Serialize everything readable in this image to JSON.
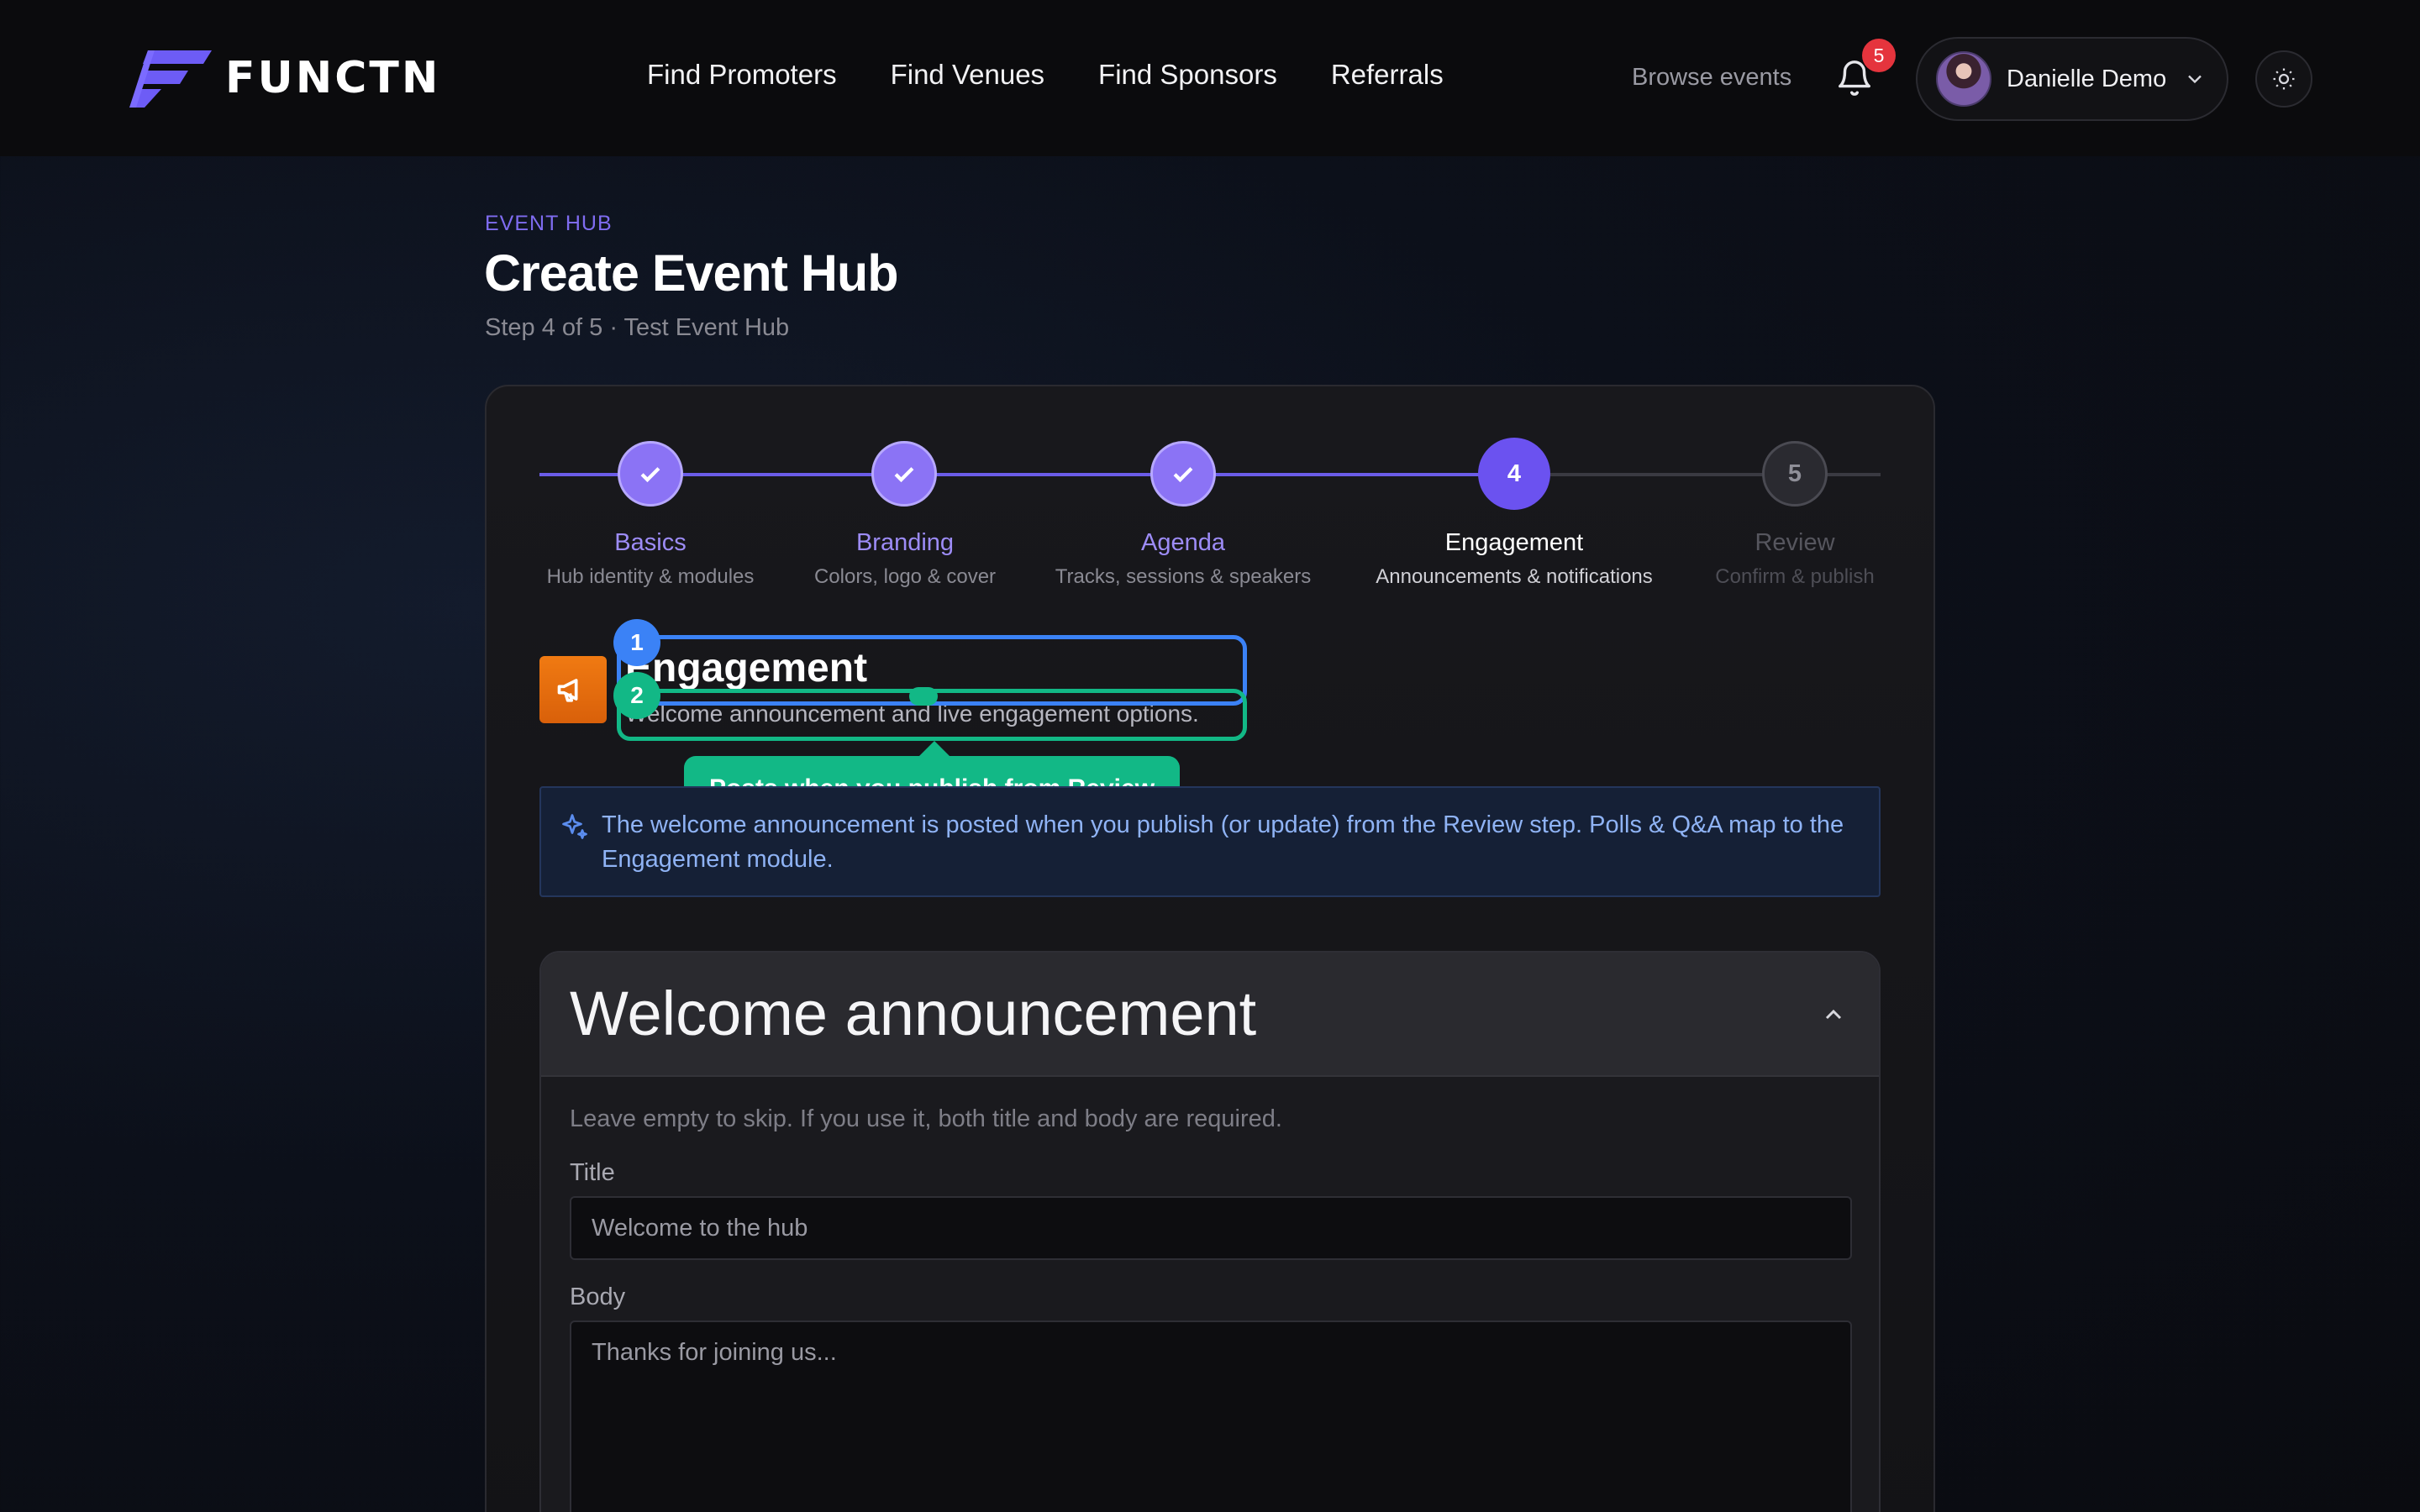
{
  "header": {
    "brand": "FUNCTN",
    "nav": [
      "Find Promoters",
      "Find Venues",
      "Find Sponsors",
      "Referrals"
    ],
    "browse_label": "Browse events",
    "notification_count": "5",
    "user_name": "Danielle Demo"
  },
  "page": {
    "eyebrow": "EVENT HUB",
    "title": "Create Event Hub",
    "subtitle": "Step 4 of 5 · Test Event Hub"
  },
  "stepper": {
    "current": 4,
    "steps": [
      {
        "label": "Basics",
        "desc": "Hub identity & modules",
        "status": "done"
      },
      {
        "label": "Branding",
        "desc": "Colors, logo & cover",
        "status": "done"
      },
      {
        "label": "Agenda",
        "desc": "Tracks, sessions & speakers",
        "status": "done"
      },
      {
        "label": "Engagement",
        "desc": "Announcements & notifications",
        "status": "active",
        "number": "4"
      },
      {
        "label": "Review",
        "desc": "Confirm & publish",
        "status": "upcoming",
        "number": "5"
      }
    ]
  },
  "section": {
    "title": "Engagement",
    "subtitle": "Welcome announcement and live engagement options."
  },
  "annotations": {
    "badge_1": "1",
    "badge_2": "2",
    "tooltip": "Posts when you publish from Review"
  },
  "info_banner": "The welcome announcement is posted when you publish (or update) from the Review step. Polls & Q&A map to the Engagement module.",
  "welcome_announcement": {
    "heading": "Welcome announcement",
    "help": "Leave empty to skip. If you use it, both title and body are required.",
    "title_label": "Title",
    "title_placeholder": "Welcome to the hub",
    "body_label": "Body",
    "body_placeholder": "Thanks for joining us..."
  },
  "colors": {
    "accent": "#6b52f0",
    "accent_done": "#8b73f5",
    "highlight_blue": "#3b82f6",
    "highlight_green": "#12b886",
    "engagement_icon": "#f07a12",
    "notification_badge": "#e5343d"
  }
}
